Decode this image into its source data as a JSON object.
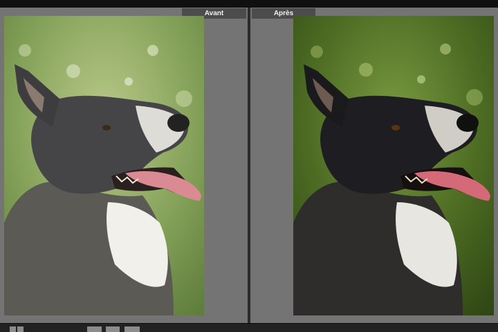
{
  "compare": {
    "before_label": "Avant",
    "after_label": "Après"
  },
  "icons": {
    "view_toggle": "grid-view-icon",
    "left_tools": "compare-layout-icon",
    "right_tools": "swap-icon",
    "third_tool": "copy-settings-icon"
  },
  "colors": {
    "panel_bg": "#747474",
    "tab_bg": "#4c4c4c",
    "chrome_bg": "#1b1b1b"
  }
}
